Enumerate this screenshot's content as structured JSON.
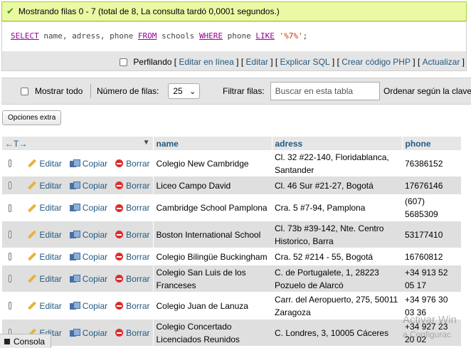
{
  "message": {
    "text": "Mostrando filas 0 - 7 (total de 8, La consulta tardó 0,0001 segundos.)",
    "icon": "check-icon"
  },
  "query": {
    "kw_select": "SELECT",
    "fields": " name, adress, phone ",
    "kw_from": "FROM",
    "table": " schools ",
    "kw_where": "WHERE",
    "column": " phone ",
    "kw_like": "LIKE",
    "space": " ",
    "pattern": "'%7%'",
    "end": ";"
  },
  "query_actions": {
    "profiling": "Perfilando",
    "edit_inline": "Editar en línea",
    "edit": "Editar",
    "explain": "Explicar SQL",
    "create_php": "Crear código PHP",
    "refresh": "Actualizar"
  },
  "navigation": {
    "show_all": "Mostrar todo",
    "rows_label": "Número de filas:",
    "rows_value": "25",
    "filter_label": "Filtrar filas:",
    "filter_placeholder": "Buscar en esta tabla",
    "sort_label": "Ordenar según la clave"
  },
  "extra_options": "Opciones extra",
  "table": {
    "headers": {
      "name": "name",
      "adress": "adress",
      "phone": "phone",
      "arrows": "←T→"
    },
    "actions": {
      "edit": "Editar",
      "copy": "Copiar",
      "delete": "Borrar"
    },
    "rows": [
      {
        "name": "Colegio New Cambridge",
        "adress": "Cl. 32 #22-140, Floridablanca, Santander",
        "phone": "76386152"
      },
      {
        "name": "Liceo Campo David",
        "adress": "Cl. 46 Sur #21-27, Bogotá",
        "phone": "17676146"
      },
      {
        "name": "Cambridge School Pamplona",
        "adress": "Cra. 5 #7-94, Pamplona",
        "phone": "(607) 5685309"
      },
      {
        "name": "Boston International School",
        "adress": "Cl. 73b #39-142, Nte. Centro Historico, Barra",
        "phone": "53177410"
      },
      {
        "name": "Colegio Bilingüe Buckingham",
        "adress": "Cra. 52 #214 - 55, Bogotá",
        "phone": "16760812"
      },
      {
        "name": "Colegio San Luis de los Franceses",
        "adress": "C. de Portugalete, 1, 28223 Pozuelo de Alarcó",
        "phone": "+34 913 52 05 17"
      },
      {
        "name": "Colegio Juan de Lanuza",
        "adress": "Carr. del Aeropuerto, 275, 50011 Zaragoza",
        "phone": "+34 976 30 03 36"
      },
      {
        "name": "Colegio Concertado Licenciados Reunidos",
        "adress": "C. Londres, 3, 10005 Cáceres",
        "phone": "+34 927 23 20 02"
      }
    ]
  },
  "console": "Consola",
  "watermark": {
    "line1": "Activar Win",
    "line2": "a Configurac"
  }
}
